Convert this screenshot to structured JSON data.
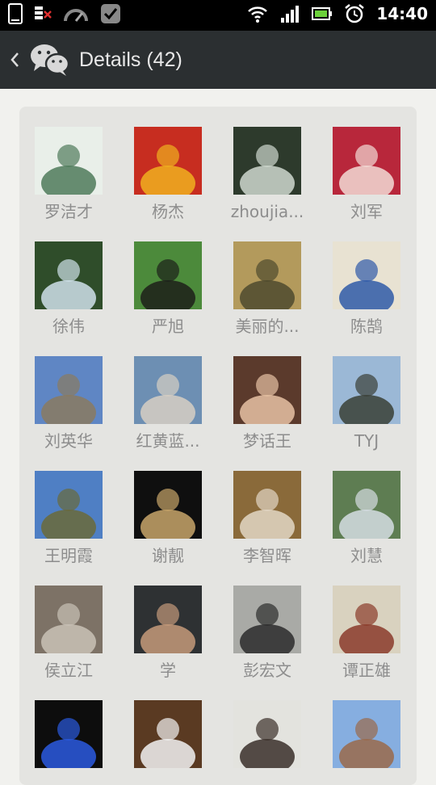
{
  "status_bar": {
    "time": "14:40"
  },
  "header": {
    "title": "Details (42)"
  },
  "members": [
    {
      "name": "罗洁才",
      "avatar": "seal-logo-avatar",
      "colors": [
        "#e9efe9",
        "#4f7a5a"
      ]
    },
    {
      "name": "杨杰",
      "avatar": "ornament-avatar",
      "colors": [
        "#c72d20",
        "#f0b020"
      ]
    },
    {
      "name": "zhoujia...",
      "avatar": "waterfall-avatar",
      "colors": [
        "#2d3a2c",
        "#cfd8cf"
      ]
    },
    {
      "name": "刘军",
      "avatar": "child-avatar",
      "colors": [
        "#b8273b",
        "#f2dcd6"
      ]
    },
    {
      "name": "徐伟",
      "avatar": "pine-trees-avatar",
      "colors": [
        "#2f4d2a",
        "#cfe1ea"
      ]
    },
    {
      "name": "严旭",
      "avatar": "couple-photo-avatar",
      "colors": [
        "#4c8a3b",
        "#1d1f1a"
      ]
    },
    {
      "name": "美丽的...",
      "avatar": "tank-avatar",
      "colors": [
        "#b39a5c",
        "#4e4a2e"
      ]
    },
    {
      "name": "陈鹄",
      "avatar": "teacup-avatar",
      "colors": [
        "#e8e2d2",
        "#2f5aa8"
      ]
    },
    {
      "name": "刘英华",
      "avatar": "cliff-avatar",
      "colors": [
        "#5f86c4",
        "#8a7a60"
      ]
    },
    {
      "name": "红黄蓝...",
      "avatar": "beach-couple-avatar",
      "colors": [
        "#6d8fb3",
        "#d7cfc3"
      ]
    },
    {
      "name": "梦话王",
      "avatar": "woman-portrait-avatar",
      "colors": [
        "#5b3a2c",
        "#e7c2a4"
      ]
    },
    {
      "name": "TYJ",
      "avatar": "pagoda-avatar",
      "colors": [
        "#9bb8d6",
        "#3a3f36"
      ]
    },
    {
      "name": "王明霞",
      "avatar": "mountain-couple-avatar",
      "colors": [
        "#4f7fc4",
        "#6a6a3a"
      ]
    },
    {
      "name": "谢靓",
      "avatar": "woman-indoor-avatar",
      "colors": [
        "#0f0f0f",
        "#c7a56a"
      ]
    },
    {
      "name": "李智晖",
      "avatar": "man-lanyard-avatar",
      "colors": [
        "#8a6a3a",
        "#e2d7c6"
      ]
    },
    {
      "name": "刘慧",
      "avatar": "hiking-group-avatar",
      "colors": [
        "#5e7d52",
        "#d5dde3"
      ]
    },
    {
      "name": "侯立江",
      "avatar": "horse-painting-avatar",
      "colors": [
        "#7d7266",
        "#c9c2b6"
      ]
    },
    {
      "name": "学",
      "avatar": "man-glasses-avatar",
      "colors": [
        "#2e3133",
        "#c49a7a"
      ]
    },
    {
      "name": "彭宏文",
      "avatar": "lakeside-man-avatar",
      "colors": [
        "#a9aaa6",
        "#2c2c2c"
      ]
    },
    {
      "name": "谭正雄",
      "avatar": "man-plaid-avatar",
      "colors": [
        "#d9d2bf",
        "#8a3b2a"
      ]
    },
    {
      "name": "",
      "avatar": "blue-flower-avatar",
      "colors": [
        "#0d0d0d",
        "#2b5be0"
      ]
    },
    {
      "name": "",
      "avatar": "coffee-cup-avatar",
      "colors": [
        "#5a3a22",
        "#f2f2f2"
      ]
    },
    {
      "name": "",
      "avatar": "man-glasses-portrait-avatar",
      "colors": [
        "#e3e3de",
        "#3a2f2a"
      ]
    },
    {
      "name": "",
      "avatar": "campus-building-avatar",
      "colors": [
        "#86aee0",
        "#9a6a4a"
      ]
    }
  ]
}
